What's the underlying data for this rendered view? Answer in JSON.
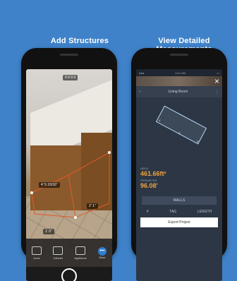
{
  "captions": {
    "left": "Add Structures",
    "right": "View Detailed Measurements"
  },
  "left_phone": {
    "top_chip": "0 0 0 0",
    "labels": {
      "m1": "4' 5 15/16\"",
      "m2": "2' 1\"",
      "m3": "1' 0\""
    },
    "toolbar": [
      {
        "label": "Undo",
        "icon": "undo-icon"
      },
      {
        "label": "Cabinet",
        "icon": "cabinet-icon"
      },
      {
        "label": "Appliance",
        "icon": "appliance-icon"
      },
      {
        "label": "More",
        "icon": "more-icon"
      }
    ]
  },
  "right_phone": {
    "status_time": "9:41 AM",
    "title": "Living Room",
    "area_label": "AREA",
    "area_value": "461.66ft²",
    "perimeter_label": "PERIMETER",
    "perimeter_value": "96.08'",
    "walls_label": "WALLS",
    "col_num": "#",
    "col_tag": "TAG",
    "col_length": "LENGTH",
    "export_label": "Export Project"
  },
  "colors": {
    "background": "#3f82c9",
    "accent": "#f0a33a"
  }
}
